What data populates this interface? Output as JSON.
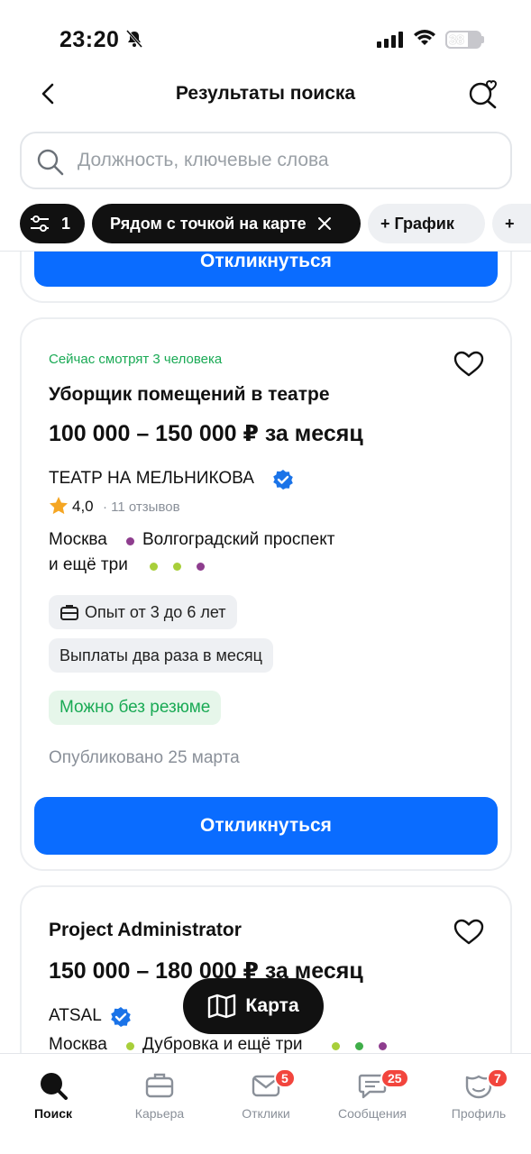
{
  "status_bar": {
    "time": "23:20",
    "battery": "38"
  },
  "header": {
    "title": "Результаты поиска"
  },
  "search": {
    "placeholder": "Должность, ключевые слова"
  },
  "chips": {
    "filter_count": "1",
    "location": "Рядом с точкой на карте",
    "schedule": "+ График",
    "more": "+"
  },
  "card_prev": {
    "apply_label": "Откликнуться"
  },
  "vacancy1": {
    "viewers": "Сейчас смотрят 3 человека",
    "title": "Уборщик помещений в театре",
    "salary": "100 000 – 150 000 ₽ за месяц",
    "company": "ТЕАТР НА МЕЛЬНИКОВА",
    "rating": "4,0",
    "reviews": "· 11 отзывов",
    "city": "Москва",
    "metro": "Волгоградский проспект",
    "metro_more": "и ещё три",
    "experience": "Опыт от 3 до 6 лет",
    "payments": "Выплаты два раза в месяц",
    "no_resume": "Можно без резюме",
    "published": "Опубликовано 25 марта",
    "apply_label": "Откликнуться"
  },
  "vacancy2": {
    "title": "Project Administrator",
    "salary": "150 000 – 180 000 ₽ за месяц",
    "company": "ATSAL",
    "city": "Москва",
    "metro": "Дубровка и ещё три"
  },
  "map_button": {
    "label": "Карта"
  },
  "tabbar": {
    "items": [
      {
        "label": "Поиск",
        "badge": ""
      },
      {
        "label": "Карьера",
        "badge": ""
      },
      {
        "label": "Отклики",
        "badge": "5"
      },
      {
        "label": "Сообщения",
        "badge": "25"
      },
      {
        "label": "Профиль",
        "badge": "7"
      }
    ]
  },
  "colors": {
    "accent": "#0a6cff",
    "green": "#1aaa55",
    "badge": "#f2453d",
    "metro_purple": "#8e3d8e",
    "metro_lime": "#a8cf3a",
    "metro_green": "#3fae49"
  }
}
